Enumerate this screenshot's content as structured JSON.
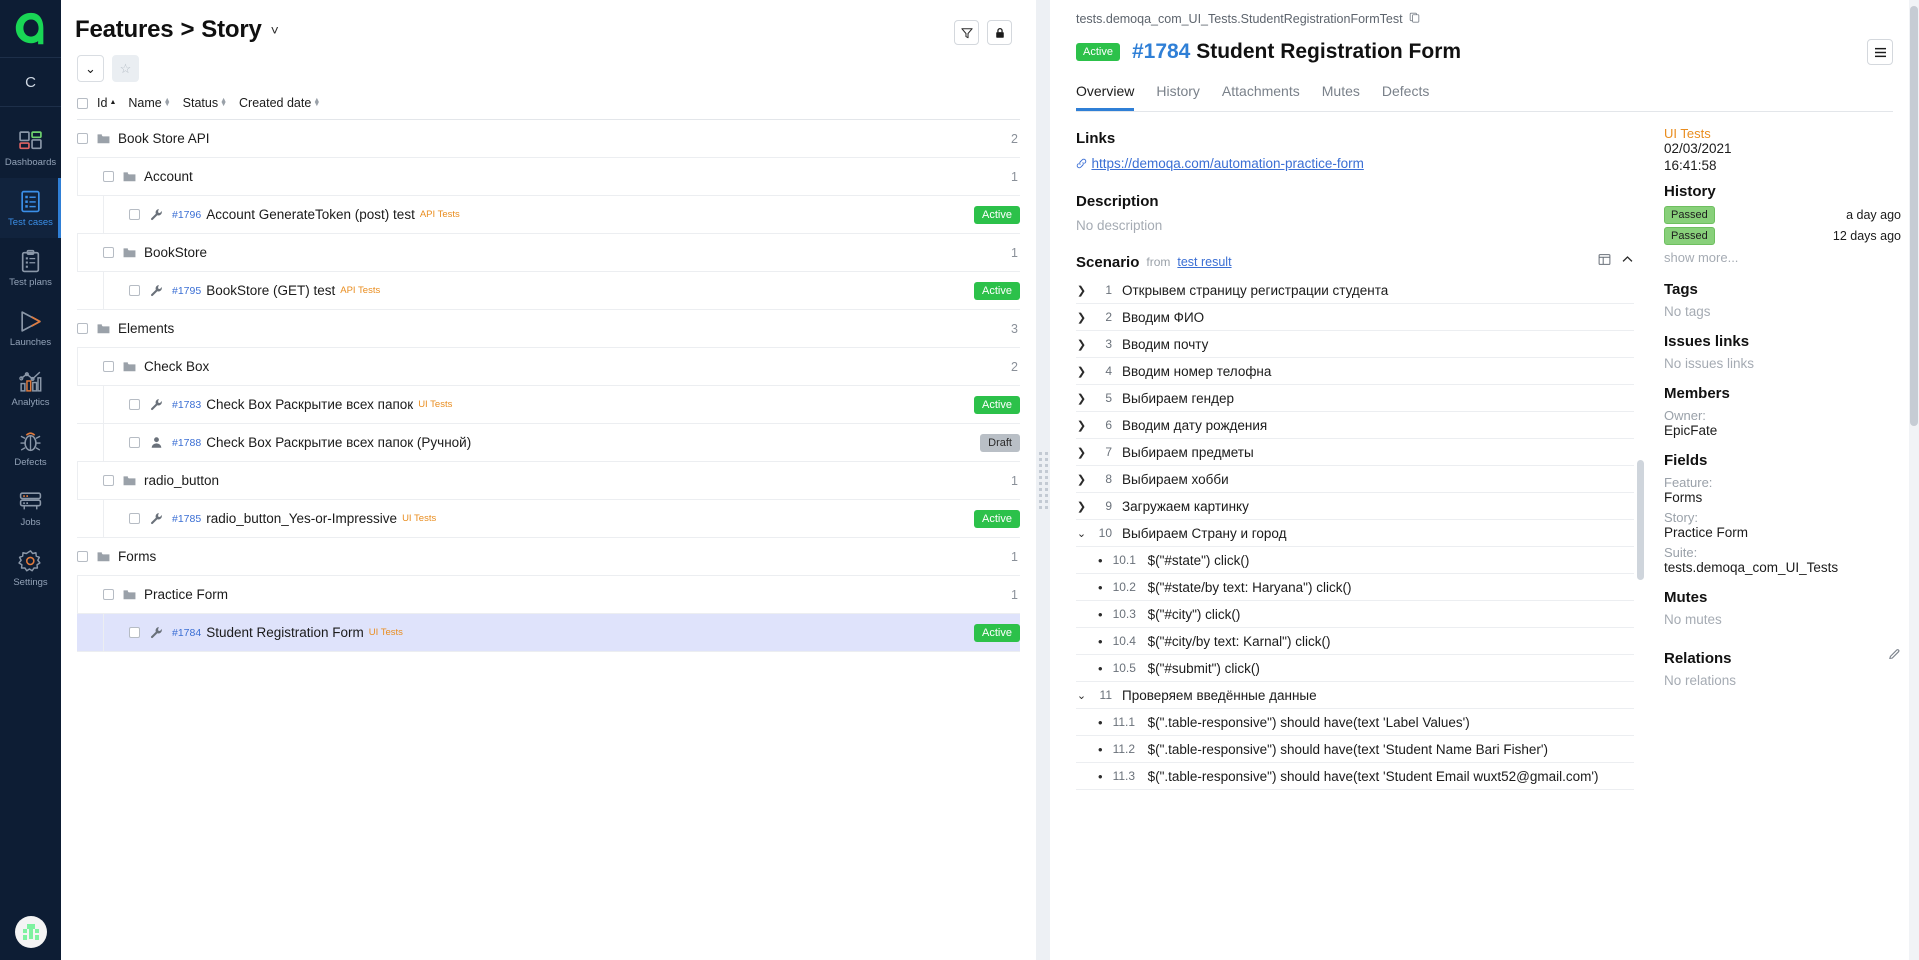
{
  "rail": {
    "logo_name": "allure-logo",
    "project_initial": "C",
    "items": [
      {
        "label": "Dashboards",
        "icon": "dashboards-icon",
        "active": false
      },
      {
        "label": "Test cases",
        "icon": "test-cases-icon",
        "active": true
      },
      {
        "label": "Test plans",
        "icon": "test-plans-icon",
        "active": false
      },
      {
        "label": "Launches",
        "icon": "launches-icon",
        "active": false
      },
      {
        "label": "Analytics",
        "icon": "analytics-icon",
        "active": false
      },
      {
        "label": "Defects",
        "icon": "defects-icon",
        "active": false
      },
      {
        "label": "Jobs",
        "icon": "jobs-icon",
        "active": false
      },
      {
        "label": "Settings",
        "icon": "settings-icon",
        "active": false
      }
    ]
  },
  "tree": {
    "breadcrumb": {
      "root": "Features",
      "separator": ">",
      "current": "Story",
      "chevron": "˅"
    },
    "head_buttons": [
      {
        "name": "filter-button",
        "glyph": "▽"
      },
      {
        "name": "lock-button",
        "glyph": "🔒"
      }
    ],
    "toolbar": [
      {
        "name": "expand-all-button",
        "glyph": "⌄"
      },
      {
        "name": "favorite-button",
        "glyph": "☆"
      }
    ],
    "columns": [
      {
        "label": "Id",
        "sorted": "asc"
      },
      {
        "label": "Name",
        "sorted": "none"
      },
      {
        "label": "Status",
        "sorted": "none"
      },
      {
        "label": "Created date",
        "sorted": "none"
      }
    ],
    "rows": [
      {
        "kind": "folder",
        "level": 0,
        "name": "Book Store API",
        "count": "2"
      },
      {
        "kind": "folder",
        "level": 1,
        "name": "Account",
        "count": "1"
      },
      {
        "kind": "test",
        "level": 2,
        "icon": "wrench-icon",
        "id": "#1796",
        "name": "Account GenerateToken (post) test",
        "tag": "API Tests",
        "status": "Active",
        "selected": false
      },
      {
        "kind": "folder",
        "level": 1,
        "name": "BookStore",
        "count": "1"
      },
      {
        "kind": "test",
        "level": 2,
        "icon": "wrench-icon",
        "id": "#1795",
        "name": "BookStore (GET) test",
        "tag": "API Tests",
        "status": "Active",
        "selected": false
      },
      {
        "kind": "folder",
        "level": 0,
        "name": "Elements",
        "count": "3"
      },
      {
        "kind": "folder",
        "level": 1,
        "name": "Check Box",
        "count": "2"
      },
      {
        "kind": "test",
        "level": 2,
        "icon": "wrench-icon",
        "id": "#1783",
        "name": "Check Box Раскрытие всех папок",
        "tag": "UI Tests",
        "status": "Active",
        "selected": false
      },
      {
        "kind": "test",
        "level": 2,
        "icon": "person-icon",
        "id": "#1788",
        "name": "Check Box Раскрытие всех папок (Ручной)",
        "tag": "",
        "status": "Draft",
        "selected": false
      },
      {
        "kind": "folder",
        "level": 1,
        "name": "radio_button",
        "count": "1"
      },
      {
        "kind": "test",
        "level": 2,
        "icon": "wrench-icon",
        "id": "#1785",
        "name": "radio_button_Yes-or-Impressive",
        "tag": "UI Tests",
        "status": "Active",
        "selected": false
      },
      {
        "kind": "folder",
        "level": 0,
        "name": "Forms",
        "count": "1"
      },
      {
        "kind": "folder",
        "level": 1,
        "name": "Practice Form",
        "count": "1"
      },
      {
        "kind": "test",
        "level": 2,
        "icon": "wrench-icon",
        "id": "#1784",
        "name": "Student Registration Form",
        "tag": "UI Tests",
        "status": "Active",
        "selected": true
      }
    ]
  },
  "detail": {
    "suite_path": "tests.demoqa_com_UI_Tests.StudentRegistrationFormTest",
    "copy_icon": "copy-icon",
    "status": "Active",
    "id": "#1784",
    "title": "Student Registration Form",
    "menu_icon": "hamburger-icon",
    "tabs": [
      {
        "label": "Overview",
        "active": true
      },
      {
        "label": "History",
        "active": false
      },
      {
        "label": "Attachments",
        "active": false
      },
      {
        "label": "Mutes",
        "active": false
      },
      {
        "label": "Defects",
        "active": false
      }
    ],
    "links": {
      "heading": "Links",
      "items": [
        {
          "text": "https://demoqa.com/automation-practice-form",
          "icon": "link-icon"
        }
      ]
    },
    "description": {
      "heading": "Description",
      "value": "No description"
    },
    "scenario": {
      "heading": "Scenario",
      "from_label": "from",
      "from_link": "test result",
      "tools": [
        {
          "name": "layout-toggle-icon",
          "glyph": "▤"
        },
        {
          "name": "collapse-icon",
          "glyph": "⌃"
        }
      ],
      "steps": [
        {
          "num": "1",
          "text": "Открывем страницу регистрации студента",
          "expanded": false,
          "substeps": []
        },
        {
          "num": "2",
          "text": "Вводим ФИО",
          "expanded": false,
          "substeps": []
        },
        {
          "num": "3",
          "text": "Вводим почту",
          "expanded": false,
          "substeps": []
        },
        {
          "num": "4",
          "text": "Вводим номер телофна",
          "expanded": false,
          "substeps": []
        },
        {
          "num": "5",
          "text": "Выбираем гендер",
          "expanded": false,
          "substeps": []
        },
        {
          "num": "6",
          "text": "Вводим дату рождения",
          "expanded": false,
          "substeps": []
        },
        {
          "num": "7",
          "text": "Выбираем предметы",
          "expanded": false,
          "substeps": []
        },
        {
          "num": "8",
          "text": "Выбираем хобби",
          "expanded": false,
          "substeps": []
        },
        {
          "num": "9",
          "text": "Загружаем картинку",
          "expanded": false,
          "substeps": []
        },
        {
          "num": "10",
          "text": "Выбираем Страну и город",
          "expanded": true,
          "substeps": [
            {
              "num": "10.1",
              "text": "$(\"#state\") click()"
            },
            {
              "num": "10.2",
              "text": "$(\"#state/by text: Haryana\") click()"
            },
            {
              "num": "10.3",
              "text": "$(\"#city\") click()"
            },
            {
              "num": "10.4",
              "text": "$(\"#city/by text: Karnal\") click()"
            },
            {
              "num": "10.5",
              "text": "$(\"#submit\") click()"
            }
          ]
        },
        {
          "num": "11",
          "text": "Проверяем введённые данные",
          "expanded": true,
          "substeps": [
            {
              "num": "11.1",
              "text": "$(\".table-responsive\") should have(text 'Label Values')"
            },
            {
              "num": "11.2",
              "text": "$(\".table-responsive\") should have(text 'Student Name Bari Fisher')"
            },
            {
              "num": "11.3",
              "text": "$(\".table-responsive\") should have(text 'Student Email wuxt52@gmail.com')"
            }
          ]
        }
      ]
    },
    "side": {
      "source_tag": "UI Tests",
      "date": "02/03/2021",
      "time": "16:41:58",
      "history": {
        "heading": "History",
        "entries": [
          {
            "status": "Passed",
            "when": "a day ago"
          },
          {
            "status": "Passed",
            "when": "12 days ago"
          }
        ],
        "show_more": "show more..."
      },
      "tags": {
        "heading": "Tags",
        "empty": "No tags"
      },
      "issues": {
        "heading": "Issues links",
        "empty": "No issues links"
      },
      "members": {
        "heading": "Members",
        "owner_label": "Owner:",
        "owner": "EpicFate"
      },
      "fields": {
        "heading": "Fields",
        "rows": [
          {
            "label": "Feature:",
            "value": "Forms"
          },
          {
            "label": "Story:",
            "value": "Practice Form"
          },
          {
            "label": "Suite:",
            "value": "tests.demoqa_com_UI_Tests"
          }
        ]
      },
      "mutes": {
        "heading": "Mutes",
        "empty": "No mutes"
      },
      "relations": {
        "heading": "Relations",
        "empty": "No relations",
        "edit_icon": "pencil-icon"
      }
    }
  },
  "colors": {
    "rail_bg": "#0d1d34",
    "accent_blue": "#2f7fd6",
    "status_active": "#2cc14a",
    "status_draft": "#b9bfc6",
    "passed_green": "#88d07a",
    "tag_orange": "#e98d1f",
    "link_blue": "#3b6fd4",
    "selected_row": "#dfe3fb"
  }
}
